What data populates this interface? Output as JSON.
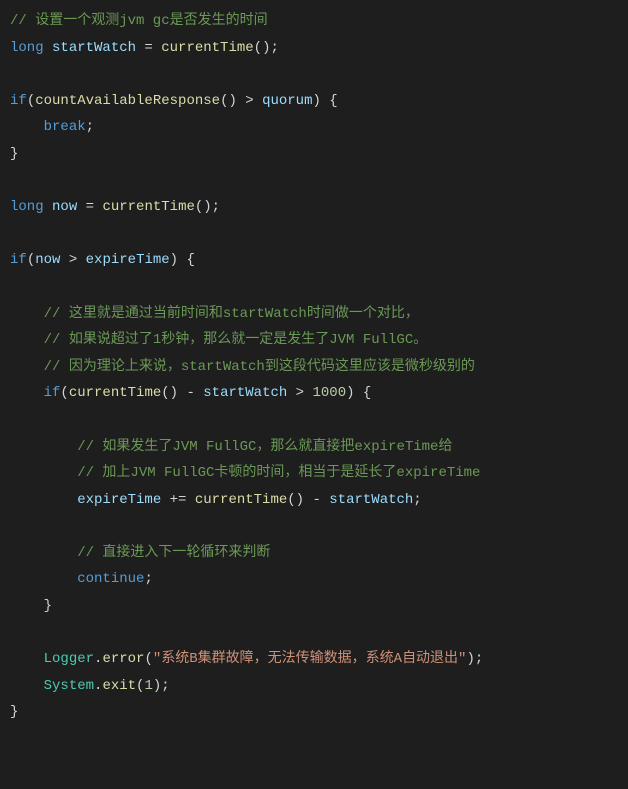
{
  "lines": [
    {
      "indent": 0,
      "tokens": [
        {
          "t": "cmt",
          "v": "// 设置一个观测jvm gc是否发生的时间"
        }
      ]
    },
    {
      "indent": 0,
      "tokens": [
        {
          "t": "kw",
          "v": "long"
        },
        {
          "t": "op",
          "v": " "
        },
        {
          "t": "var",
          "v": "startWatch"
        },
        {
          "t": "op",
          "v": " = "
        },
        {
          "t": "fn",
          "v": "currentTime"
        },
        {
          "t": "op",
          "v": "();"
        }
      ]
    },
    {
      "indent": 0,
      "tokens": [
        {
          "t": "op",
          "v": " "
        }
      ]
    },
    {
      "indent": 0,
      "tokens": [
        {
          "t": "kw",
          "v": "if"
        },
        {
          "t": "op",
          "v": "("
        },
        {
          "t": "fn",
          "v": "countAvailableResponse"
        },
        {
          "t": "op",
          "v": "() > "
        },
        {
          "t": "var",
          "v": "quorum"
        },
        {
          "t": "op",
          "v": ") {"
        }
      ]
    },
    {
      "indent": 1,
      "tokens": [
        {
          "t": "kw",
          "v": "break"
        },
        {
          "t": "op",
          "v": ";"
        }
      ]
    },
    {
      "indent": 0,
      "tokens": [
        {
          "t": "op",
          "v": "}"
        }
      ]
    },
    {
      "indent": 0,
      "tokens": [
        {
          "t": "op",
          "v": " "
        }
      ]
    },
    {
      "indent": 0,
      "tokens": [
        {
          "t": "kw",
          "v": "long"
        },
        {
          "t": "op",
          "v": " "
        },
        {
          "t": "var",
          "v": "now"
        },
        {
          "t": "op",
          "v": " = "
        },
        {
          "t": "fn",
          "v": "currentTime"
        },
        {
          "t": "op",
          "v": "();"
        }
      ]
    },
    {
      "indent": 0,
      "tokens": [
        {
          "t": "op",
          "v": " "
        }
      ]
    },
    {
      "indent": 0,
      "tokens": [
        {
          "t": "kw",
          "v": "if"
        },
        {
          "t": "op",
          "v": "("
        },
        {
          "t": "var",
          "v": "now"
        },
        {
          "t": "op",
          "v": " > "
        },
        {
          "t": "var",
          "v": "expireTime"
        },
        {
          "t": "op",
          "v": ") {"
        }
      ]
    },
    {
      "indent": 0,
      "tokens": [
        {
          "t": "op",
          "v": " "
        }
      ]
    },
    {
      "indent": 1,
      "tokens": [
        {
          "t": "cmt",
          "v": "// 这里就是通过当前时间和startWatch时间做一个对比，"
        }
      ]
    },
    {
      "indent": 1,
      "tokens": [
        {
          "t": "cmt",
          "v": "// 如果说超过了1秒钟，那么就一定是发生了JVM FullGC。"
        }
      ]
    },
    {
      "indent": 1,
      "tokens": [
        {
          "t": "cmt",
          "v": "// 因为理论上来说，startWatch到这段代码这里应该是微秒级别的"
        }
      ]
    },
    {
      "indent": 1,
      "tokens": [
        {
          "t": "kw",
          "v": "if"
        },
        {
          "t": "op",
          "v": "("
        },
        {
          "t": "fn",
          "v": "currentTime"
        },
        {
          "t": "op",
          "v": "() - "
        },
        {
          "t": "var",
          "v": "startWatch"
        },
        {
          "t": "op",
          "v": " > "
        },
        {
          "t": "num",
          "v": "1000"
        },
        {
          "t": "op",
          "v": ") {"
        }
      ]
    },
    {
      "indent": 0,
      "tokens": [
        {
          "t": "op",
          "v": " "
        }
      ]
    },
    {
      "indent": 2,
      "tokens": [
        {
          "t": "cmt",
          "v": "// 如果发生了JVM FullGC，那么就直接把expireTime给"
        }
      ]
    },
    {
      "indent": 2,
      "tokens": [
        {
          "t": "cmt",
          "v": "// 加上JVM FullGC卡顿的时间，相当于是延长了expireTime"
        }
      ]
    },
    {
      "indent": 2,
      "tokens": [
        {
          "t": "var",
          "v": "expireTime"
        },
        {
          "t": "op",
          "v": " += "
        },
        {
          "t": "fn",
          "v": "currentTime"
        },
        {
          "t": "op",
          "v": "() - "
        },
        {
          "t": "var",
          "v": "startWatch"
        },
        {
          "t": "op",
          "v": ";"
        }
      ]
    },
    {
      "indent": 0,
      "tokens": [
        {
          "t": "op",
          "v": " "
        }
      ]
    },
    {
      "indent": 2,
      "tokens": [
        {
          "t": "cmt",
          "v": "// 直接进入下一轮循环来判断"
        }
      ]
    },
    {
      "indent": 2,
      "tokens": [
        {
          "t": "kw",
          "v": "continue"
        },
        {
          "t": "op",
          "v": ";"
        }
      ]
    },
    {
      "indent": 1,
      "tokens": [
        {
          "t": "op",
          "v": "}"
        }
      ]
    },
    {
      "indent": 0,
      "tokens": [
        {
          "t": "op",
          "v": " "
        }
      ]
    },
    {
      "indent": 1,
      "tokens": [
        {
          "t": "cls",
          "v": "Logger"
        },
        {
          "t": "op",
          "v": "."
        },
        {
          "t": "fn",
          "v": "error"
        },
        {
          "t": "op",
          "v": "("
        },
        {
          "t": "str",
          "v": "\"系统B集群故障，无法传输数据，系统A自动退出\""
        },
        {
          "t": "op",
          "v": ");"
        }
      ]
    },
    {
      "indent": 1,
      "tokens": [
        {
          "t": "cls",
          "v": "System"
        },
        {
          "t": "op",
          "v": "."
        },
        {
          "t": "fn",
          "v": "exit"
        },
        {
          "t": "op",
          "v": "("
        },
        {
          "t": "num",
          "v": "1"
        },
        {
          "t": "op",
          "v": ");"
        }
      ]
    },
    {
      "indent": 0,
      "tokens": [
        {
          "t": "op",
          "v": "}"
        }
      ]
    }
  ],
  "indentUnit": "    "
}
